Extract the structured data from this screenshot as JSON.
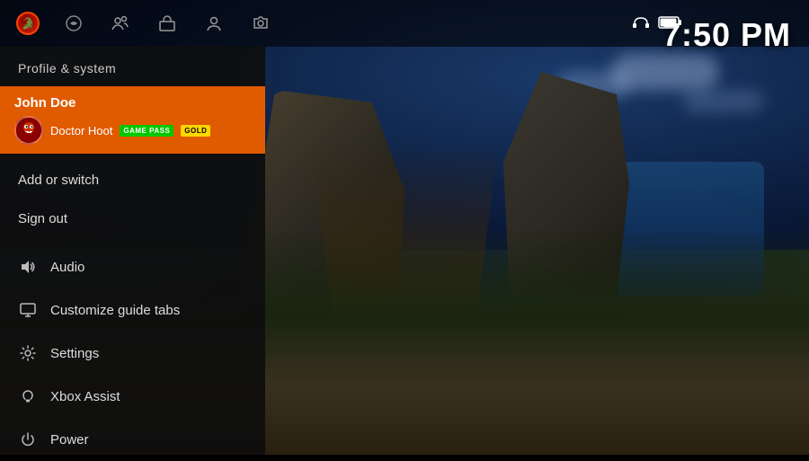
{
  "topbar": {
    "nav_items": [
      {
        "id": "home",
        "label": "Home",
        "icon": "⊞"
      },
      {
        "id": "profile",
        "label": "Profile",
        "icon": "👤"
      },
      {
        "id": "social",
        "label": "Social",
        "icon": "👥"
      },
      {
        "id": "store",
        "label": "Store",
        "icon": "🛒"
      },
      {
        "id": "capture",
        "label": "Capture",
        "icon": "📷"
      }
    ]
  },
  "time": "7:50 PM",
  "status_icons": {
    "headset": "🎧",
    "battery": "🔋"
  },
  "panel": {
    "title": "Profile & system",
    "user": {
      "name": "John Doe",
      "gamertag": "Doctor Hoot",
      "badges": [
        {
          "label": "GAME PASS",
          "type": "gamepass"
        },
        {
          "label": "GOLD",
          "type": "gold"
        }
      ]
    },
    "menu_items_simple": [
      {
        "id": "add-switch",
        "label": "Add or switch"
      },
      {
        "id": "sign-out",
        "label": "Sign out"
      }
    ],
    "menu_items_icon": [
      {
        "id": "audio",
        "label": "Audio",
        "icon": "audio"
      },
      {
        "id": "customize-guide",
        "label": "Customize guide tabs",
        "icon": "monitor"
      },
      {
        "id": "settings",
        "label": "Settings",
        "icon": "gear"
      },
      {
        "id": "xbox-assist",
        "label": "Xbox Assist",
        "icon": "bulb"
      },
      {
        "id": "power",
        "label": "Power",
        "icon": "power"
      }
    ]
  }
}
